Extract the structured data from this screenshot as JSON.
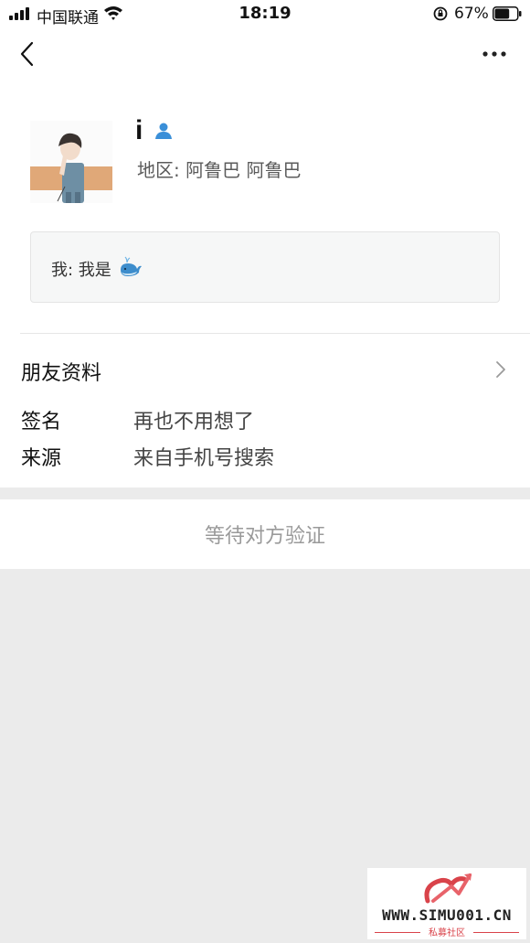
{
  "status_bar": {
    "carrier": "中国联通",
    "time": "18:19",
    "battery_percent": "67%",
    "battery_level": 0.67
  },
  "nav": {
    "back_icon": "chevron-left-icon",
    "more_icon": "more-dots-icon"
  },
  "profile": {
    "name": "i",
    "region": "地区: 阿鲁巴 阿鲁巴",
    "message": "我: 我是",
    "message_emoji": "whale-icon"
  },
  "friend_info": {
    "title": "朋友资料",
    "rows": [
      {
        "label": "签名",
        "value": "再也不用想了"
      },
      {
        "label": "来源",
        "value": "来自手机号搜索"
      }
    ]
  },
  "action": {
    "label": "等待对方验证"
  },
  "watermark": {
    "text": "WWW.SIMU001.CN",
    "subtext": "私募社区",
    "accent_color": "#d9434a"
  }
}
